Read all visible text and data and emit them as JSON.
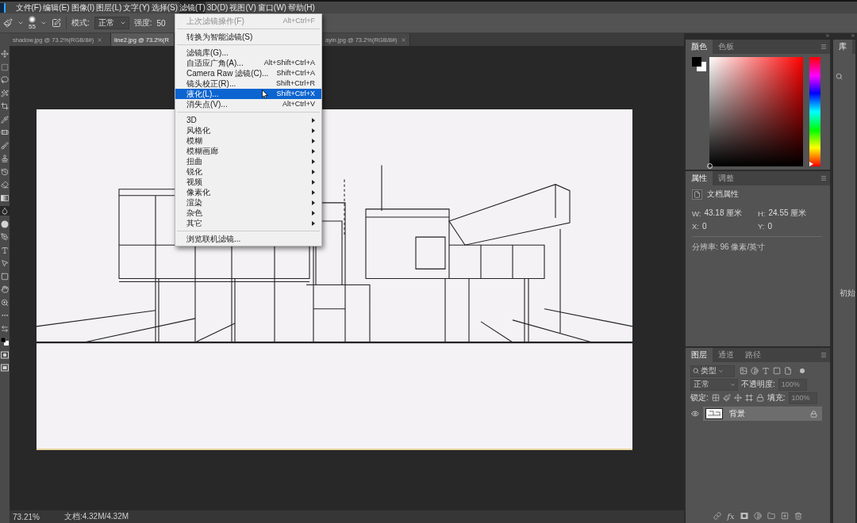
{
  "menu_bar": {
    "items": [
      {
        "label": "文件(F)",
        "selected": false
      },
      {
        "label": "编辑(E)",
        "selected": false
      },
      {
        "label": "图像(I)",
        "selected": false
      },
      {
        "label": "图层(L)",
        "selected": false
      },
      {
        "label": "文字(Y)",
        "selected": false
      },
      {
        "label": "选择(S)",
        "selected": false
      },
      {
        "label": "滤镜(T)",
        "selected": true
      },
      {
        "label": "3D(D)",
        "selected": false
      },
      {
        "label": "视图(V)",
        "selected": false
      },
      {
        "label": "窗口(W)",
        "selected": false
      },
      {
        "label": "帮助(H)",
        "selected": false
      }
    ]
  },
  "options_bar": {
    "brush_size": "55",
    "mode_label": "模式:",
    "mode_value": "正常",
    "strength_label": "强度:",
    "strength_value": "50"
  },
  "document_tabs": [
    {
      "label": "shadow.jpg @ 73.2%(RGB/8#)",
      "selected": false,
      "close_button": true
    },
    {
      "label": "line2.jpg @ 73.2%(R",
      "selected": true,
      "close_button": false
    },
    {
      "label": "ayin.jpg @ 73.2%(RGB/8#)",
      "selected": false,
      "close_button": true
    }
  ],
  "toolbar": {
    "tools": [
      {
        "kind": "move",
        "selected": false
      },
      {
        "kind": "marquee",
        "selected": false
      },
      {
        "kind": "lasso",
        "selected": false
      },
      {
        "kind": "quick-select",
        "selected": false
      },
      {
        "kind": "crop",
        "selected": false
      },
      {
        "kind": "eyedropper",
        "selected": false
      },
      {
        "kind": "healing",
        "selected": false
      },
      {
        "kind": "brush",
        "selected": false
      },
      {
        "kind": "stamp",
        "selected": false
      },
      {
        "kind": "history-brush",
        "selected": false
      },
      {
        "kind": "eraser",
        "selected": false
      },
      {
        "kind": "gradient",
        "selected": false
      },
      {
        "kind": "blur",
        "selected": true
      },
      {
        "kind": "dodge",
        "selected": false
      },
      {
        "kind": "pen",
        "selected": false
      },
      {
        "kind": "type",
        "selected": false
      },
      {
        "kind": "path-select",
        "selected": false
      },
      {
        "kind": "rectangle",
        "selected": false
      },
      {
        "kind": "hand",
        "selected": false
      },
      {
        "kind": "zoom",
        "selected": false
      },
      {
        "kind": "more",
        "selected": false
      },
      {
        "kind": "swap",
        "selected": false
      },
      {
        "kind": "colors",
        "selected": false
      },
      {
        "kind": "quick-mask",
        "selected": false
      },
      {
        "kind": "screen-mode",
        "selected": false
      }
    ]
  },
  "filter_menu": {
    "groups": [
      {
        "items": [
          {
            "kind": "command",
            "label": "上次滤镜操作(F)",
            "shortcut": "Alt+Ctrl+F",
            "disabled": true,
            "highlighted": false
          }
        ]
      },
      {
        "items": [
          {
            "kind": "command",
            "label": "转换为智能滤镜(S)",
            "disabled": false,
            "highlighted": false
          }
        ]
      },
      {
        "items": [
          {
            "kind": "command",
            "label": "滤镜库(G)...",
            "disabled": false,
            "highlighted": false
          },
          {
            "kind": "command",
            "label": "自适应广角(A)...",
            "shortcut": "Alt+Shift+Ctrl+A",
            "disabled": false,
            "highlighted": false
          },
          {
            "kind": "command",
            "label": "Camera Raw 滤镜(C)...",
            "shortcut": "Shift+Ctrl+A",
            "disabled": false,
            "highlighted": false
          },
          {
            "kind": "command",
            "label": "镜头校正(R)...",
            "shortcut": "Shift+Ctrl+R",
            "disabled": false,
            "highlighted": false
          },
          {
            "kind": "command",
            "label": "液化(L)...",
            "shortcut": "Shift+Ctrl+X",
            "disabled": false,
            "highlighted": true
          },
          {
            "kind": "command",
            "label": "消失点(V)...",
            "shortcut": "Alt+Ctrl+V",
            "disabled": false,
            "highlighted": false
          }
        ]
      },
      {
        "items": [
          {
            "kind": "submenu",
            "label": "3D",
            "disabled": false,
            "highlighted": false
          },
          {
            "kind": "submenu",
            "label": "风格化",
            "disabled": false,
            "highlighted": false
          },
          {
            "kind": "submenu",
            "label": "模糊",
            "disabled": false,
            "highlighted": false
          },
          {
            "kind": "submenu",
            "label": "模糊画廊",
            "disabled": false,
            "highlighted": false
          },
          {
            "kind": "submenu",
            "label": "扭曲",
            "disabled": false,
            "highlighted": false
          },
          {
            "kind": "submenu",
            "label": "锐化",
            "disabled": false,
            "highlighted": false
          },
          {
            "kind": "submenu",
            "label": "视频",
            "disabled": false,
            "highlighted": false
          },
          {
            "kind": "submenu",
            "label": "像素化",
            "disabled": false,
            "highlighted": false
          },
          {
            "kind": "submenu",
            "label": "渲染",
            "disabled": false,
            "highlighted": false
          },
          {
            "kind": "submenu",
            "label": "杂色",
            "disabled": false,
            "highlighted": false
          },
          {
            "kind": "submenu",
            "label": "其它",
            "disabled": false,
            "highlighted": false
          }
        ]
      },
      {
        "items": [
          {
            "kind": "command",
            "label": "浏览联机滤镜...",
            "disabled": false,
            "highlighted": false
          }
        ]
      }
    ]
  },
  "color_panel": {
    "tabs": [
      {
        "label": "颜色",
        "selected": true
      },
      {
        "label": "色板",
        "selected": false
      }
    ],
    "swatches": [
      {
        "color": "#000000"
      },
      {
        "color": "#ffffff"
      }
    ],
    "hue": {
      "level": 0
    }
  },
  "properties_panel": {
    "tabs": [
      {
        "label": "属性",
        "selected": true
      },
      {
        "label": "调整",
        "selected": false
      }
    ],
    "title": "文档属性",
    "fields": [
      {
        "label": "W:",
        "value": "43.18 厘米"
      },
      {
        "label": "H:",
        "value": "24.55 厘米"
      },
      {
        "label": "X:",
        "value": "0"
      },
      {
        "label": "Y:",
        "value": "0"
      }
    ],
    "resolution": "分辨率: 96 像素/英寸"
  },
  "layers_panel": {
    "tabs": [
      {
        "label": "图层",
        "selected": true
      },
      {
        "label": "通道",
        "selected": false
      },
      {
        "label": "路径",
        "selected": false
      }
    ],
    "filter_kind": "类型",
    "blend_mode": "正常",
    "opacity_label": "不透明度:",
    "opacity_value": "100%",
    "lock_label": "锁定:",
    "fill_label": "填充:",
    "fill_value": "100%",
    "layers": [
      {
        "name": "背景",
        "visible": true,
        "locked": true,
        "selected": true
      }
    ],
    "effects_label": "fx"
  },
  "libraries_panel": {
    "tabs": [
      {
        "label": "库",
        "selected": true
      }
    ],
    "text": "初始"
  },
  "status_bar": {
    "zoom": "73.21%",
    "document_size": "文档:4.32M/4.32M"
  }
}
